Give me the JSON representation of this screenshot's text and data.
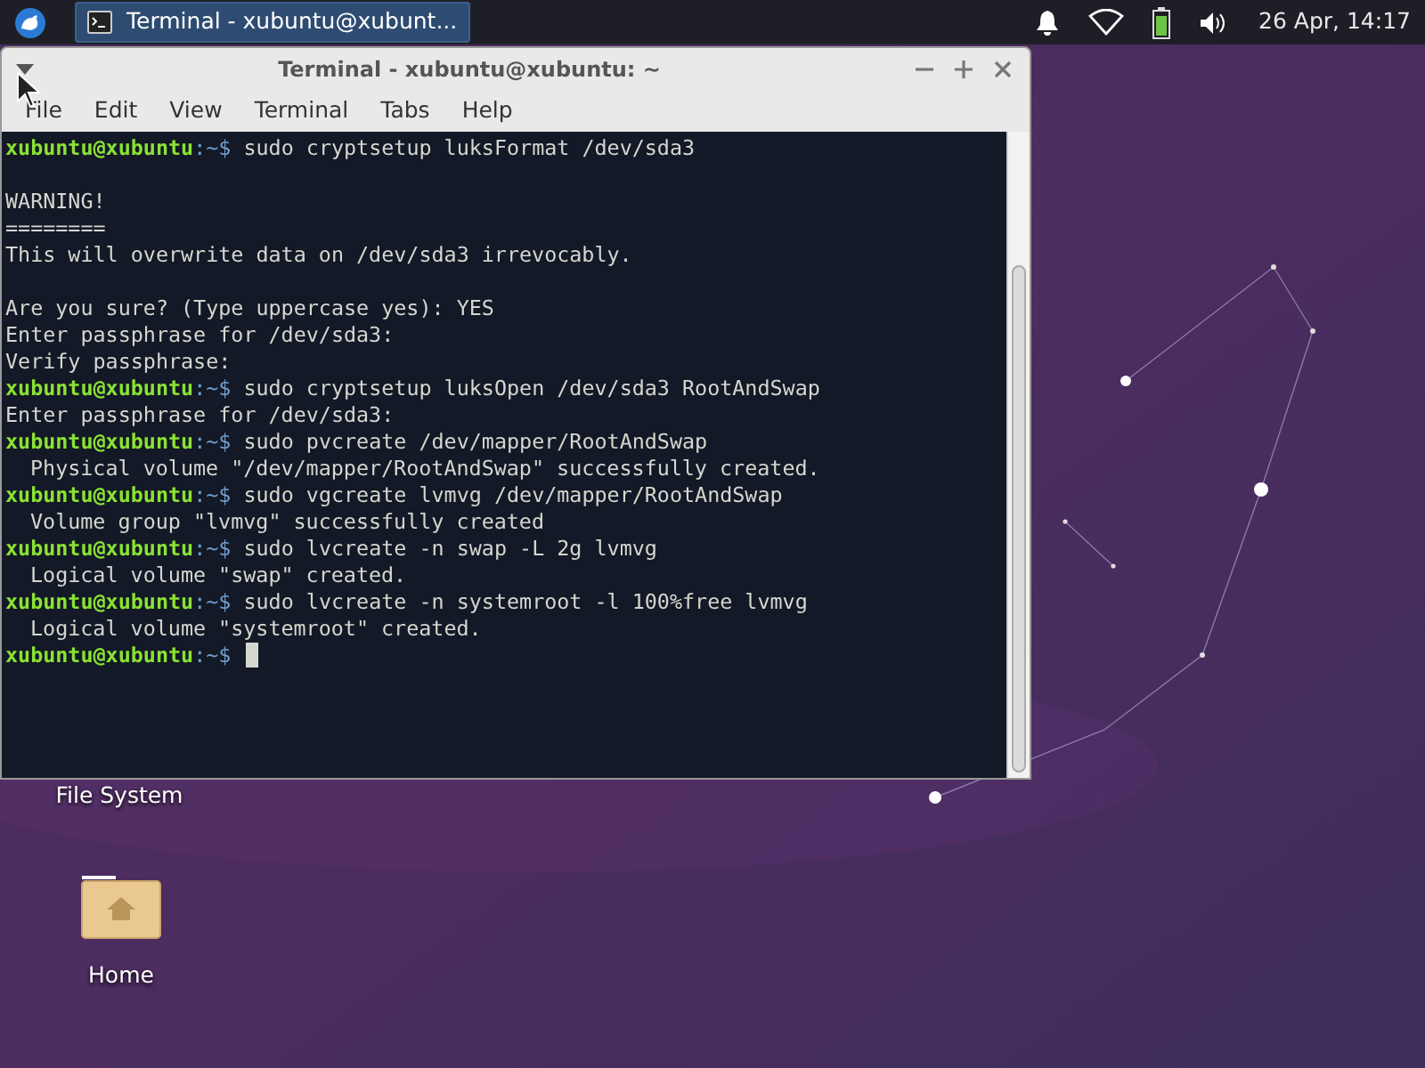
{
  "panel": {
    "taskbar": [
      {
        "label": "Terminal - xubuntu@xubunt...",
        "selected": true
      }
    ],
    "clock": "26 Apr, 14:17"
  },
  "window": {
    "title": "Terminal - xubuntu@xubuntu: ~",
    "menu": [
      "File",
      "Edit",
      "View",
      "Terminal",
      "Tabs",
      "Help"
    ],
    "lines": [
      {
        "kind": "prompt",
        "user": "xubuntu@xubuntu",
        "path": ":~$",
        "command": "sudo cryptsetup luksFormat /dev/sda3"
      },
      {
        "kind": "blank"
      },
      {
        "kind": "output",
        "text": "WARNING!"
      },
      {
        "kind": "output",
        "text": "========"
      },
      {
        "kind": "output",
        "text": "This will overwrite data on /dev/sda3 irrevocably."
      },
      {
        "kind": "blank"
      },
      {
        "kind": "output",
        "text": "Are you sure? (Type uppercase yes): YES"
      },
      {
        "kind": "output",
        "text": "Enter passphrase for /dev/sda3:"
      },
      {
        "kind": "output",
        "text": "Verify passphrase:"
      },
      {
        "kind": "prompt",
        "user": "xubuntu@xubuntu",
        "path": ":~$",
        "command": "sudo cryptsetup luksOpen /dev/sda3 RootAndSwap"
      },
      {
        "kind": "output",
        "text": "Enter passphrase for /dev/sda3:"
      },
      {
        "kind": "prompt",
        "user": "xubuntu@xubuntu",
        "path": ":~$",
        "command": "sudo pvcreate /dev/mapper/RootAndSwap"
      },
      {
        "kind": "detail",
        "text": "Physical volume \"/dev/mapper/RootAndSwap\" successfully created."
      },
      {
        "kind": "prompt",
        "user": "xubuntu@xubuntu",
        "path": ":~$",
        "command": "sudo vgcreate lvmvg /dev/mapper/RootAndSwap"
      },
      {
        "kind": "detail",
        "text": "Volume group \"lvmvg\" successfully created"
      },
      {
        "kind": "prompt",
        "user": "xubuntu@xubuntu",
        "path": ":~$",
        "command": "sudo lvcreate -n swap -L 2g lvmvg"
      },
      {
        "kind": "detail",
        "text": "Logical volume \"swap\" created."
      },
      {
        "kind": "prompt",
        "user": "xubuntu@xubuntu",
        "path": ":~$",
        "command": "sudo lvcreate -n systemroot -l 100%free lvmvg"
      },
      {
        "kind": "detail",
        "text": "Logical volume \"systemroot\" created."
      },
      {
        "kind": "cursor",
        "user": "xubuntu@xubuntu",
        "path": ":~$"
      }
    ]
  },
  "desktop_icons": [
    {
      "kind": "filesystem",
      "label": "File System"
    },
    {
      "kind": "home",
      "label": "Home"
    }
  ]
}
